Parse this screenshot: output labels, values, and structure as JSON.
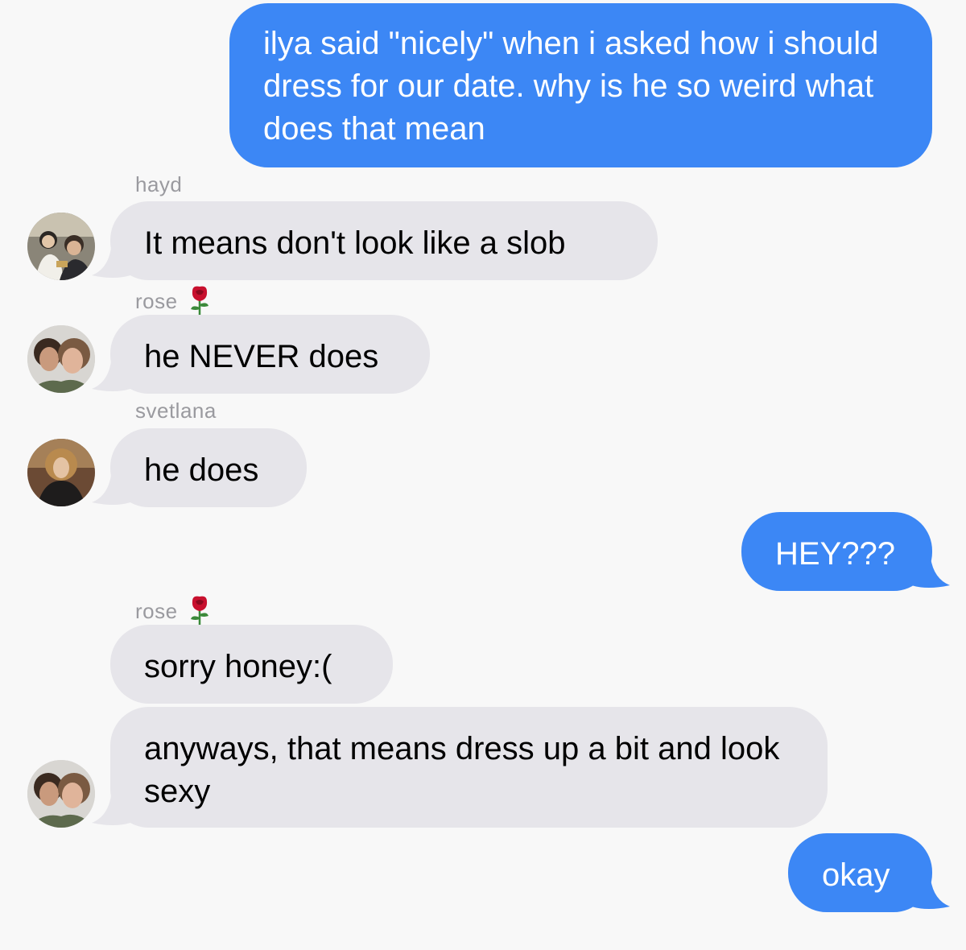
{
  "colors": {
    "outgoing": "#3c87f5",
    "incoming": "#e6e5ea",
    "background": "#f8f8f8",
    "sender_name": "#9a9a9f"
  },
  "messages": [
    {
      "direction": "out",
      "text": "ilya said \"nicely\" when i asked how i should dress for our date. why is he so weird what does that mean"
    },
    {
      "direction": "in",
      "sender": "hayd",
      "avatar": "hayd-avatar",
      "text": "It means don't look like a slob"
    },
    {
      "direction": "in",
      "sender": "rose",
      "sender_emoji": "rose-emoji-icon",
      "avatar": "rose-avatar",
      "text": "he NEVER does"
    },
    {
      "direction": "in",
      "sender": "svetlana",
      "avatar": "svetlana-avatar",
      "text": "he does"
    },
    {
      "direction": "out",
      "text": "HEY???"
    },
    {
      "direction": "in",
      "sender": "rose",
      "sender_emoji": "rose-emoji-icon",
      "text": "sorry honey:("
    },
    {
      "direction": "in",
      "avatar": "rose-avatar",
      "text": "anyways, that means dress up a bit and look sexy"
    },
    {
      "direction": "out",
      "text": "okay"
    }
  ]
}
